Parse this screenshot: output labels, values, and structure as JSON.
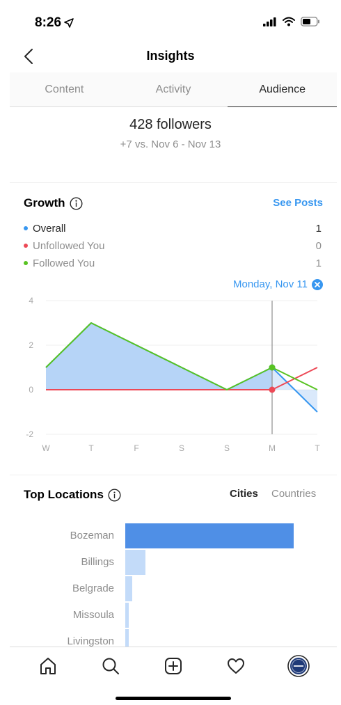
{
  "status_bar": {
    "time": "8:26",
    "icons": [
      "location-arrow-icon",
      "signal-icon",
      "wifi-icon",
      "battery-icon"
    ]
  },
  "header": {
    "title": "Insights",
    "back_icon": "chevron-left-icon"
  },
  "tabs": [
    {
      "label": "Content",
      "active": false
    },
    {
      "label": "Activity",
      "active": false
    },
    {
      "label": "Audience",
      "active": true
    }
  ],
  "summary": {
    "followers": "428 followers",
    "delta": "+7 vs. Nov 6 - Nov 13"
  },
  "growth": {
    "title": "Growth",
    "link": "See Posts",
    "legend": [
      {
        "label": "Overall",
        "value": "1",
        "color": "#3897f0"
      },
      {
        "label": "Unfollowed You",
        "value": "0",
        "color": "#ed4956"
      },
      {
        "label": "Followed You",
        "value": "1",
        "color": "#58c322"
      }
    ],
    "selected_date": "Monday, Nov 11"
  },
  "chart_data": {
    "type": "line",
    "x": [
      "W",
      "T",
      "F",
      "S",
      "S",
      "M",
      "T"
    ],
    "y_ticks": [
      "4",
      "2",
      "0",
      "-2"
    ],
    "ylim": [
      -2,
      4
    ],
    "selected_index": 5,
    "series": [
      {
        "name": "Overall",
        "color": "#3897f0",
        "fill": "#b6d4f7",
        "values": [
          1,
          3,
          2,
          1,
          0,
          1,
          -1
        ]
      },
      {
        "name": "Unfollowed You",
        "color": "#ed4956",
        "values": [
          0,
          0,
          0,
          0,
          0,
          0,
          1
        ]
      },
      {
        "name": "Followed You",
        "color": "#58c322",
        "values": [
          1,
          3,
          2,
          1,
          0,
          1,
          0
        ]
      }
    ]
  },
  "locations": {
    "title": "Top Locations",
    "toggle": [
      {
        "label": "Cities",
        "active": true
      },
      {
        "label": "Countries",
        "active": false
      }
    ],
    "items": [
      {
        "label": "Bozeman",
        "share": 1.0,
        "color": "#4f8fe6"
      },
      {
        "label": "Billings",
        "share": 0.12,
        "color": "#c3dbf9"
      },
      {
        "label": "Belgrade",
        "share": 0.04,
        "color": "#c3dbf9"
      },
      {
        "label": "Missoula",
        "share": 0.02,
        "color": "#c3dbf9"
      },
      {
        "label": "Livingston",
        "share": 0.02,
        "color": "#c3dbf9"
      }
    ]
  },
  "tabbar": {
    "items": [
      "home-icon",
      "search-icon",
      "new-post-icon",
      "activity-heart-icon",
      "profile-avatar"
    ]
  }
}
